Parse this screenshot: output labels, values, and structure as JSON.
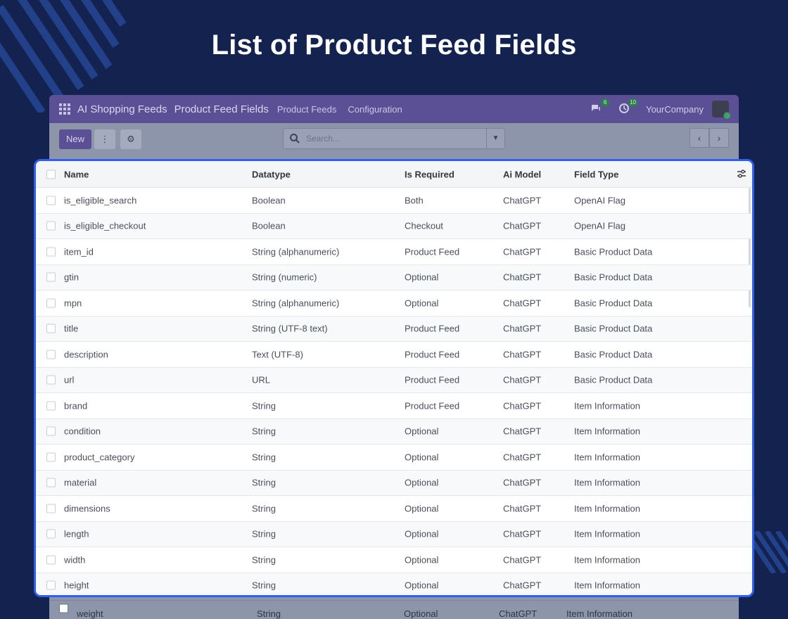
{
  "hero": {
    "title": "List of Product Feed Fields"
  },
  "navbar": {
    "app_name": "AI Shopping Feeds",
    "page_name": "Product Feed Fields",
    "menus": [
      "Product Feeds",
      "Configuration"
    ],
    "messages_count": "6",
    "activities_count": "10",
    "company": "YourCompany"
  },
  "controls": {
    "new_label": "New",
    "gear_icon": "gear-icon",
    "search_placeholder": "Search..."
  },
  "table": {
    "headers": [
      "Name",
      "Datatype",
      "Is Required",
      "Ai Model",
      "Field Type"
    ],
    "rows": [
      [
        "is_eligible_search",
        "Boolean",
        "Both",
        "ChatGPT",
        "OpenAI Flag"
      ],
      [
        "is_eligible_checkout",
        "Boolean",
        "Checkout",
        "ChatGPT",
        "OpenAI Flag"
      ],
      [
        "item_id",
        "String (alphanumeric)",
        "Product Feed",
        "ChatGPT",
        "Basic Product Data"
      ],
      [
        "gtin",
        "String (numeric)",
        "Optional",
        "ChatGPT",
        "Basic Product Data"
      ],
      [
        "mpn",
        "String (alphanumeric)",
        "Optional",
        "ChatGPT",
        "Basic Product Data"
      ],
      [
        "title",
        "String (UTF-8 text)",
        "Product Feed",
        "ChatGPT",
        "Basic Product Data"
      ],
      [
        "description",
        "Text (UTF-8)",
        "Product Feed",
        "ChatGPT",
        "Basic Product Data"
      ],
      [
        "url",
        "URL",
        "Product Feed",
        "ChatGPT",
        "Basic Product Data"
      ],
      [
        "brand",
        "String",
        "Product Feed",
        "ChatGPT",
        "Item Information"
      ],
      [
        "condition",
        "String",
        "Optional",
        "ChatGPT",
        "Item Information"
      ],
      [
        "product_category",
        "String",
        "Optional",
        "ChatGPT",
        "Item Information"
      ],
      [
        "material",
        "String",
        "Optional",
        "ChatGPT",
        "Item Information"
      ],
      [
        "dimensions",
        "String",
        "Optional",
        "ChatGPT",
        "Item Information"
      ],
      [
        "length",
        "String",
        "Optional",
        "ChatGPT",
        "Item Information"
      ],
      [
        "width",
        "String",
        "Optional",
        "ChatGPT",
        "Item Information"
      ],
      [
        "height",
        "String",
        "Optional",
        "ChatGPT",
        "Item Information"
      ]
    ],
    "below_row": [
      "weight",
      "String",
      "Optional",
      "ChatGPT",
      "Item Information"
    ]
  },
  "colors": {
    "background": "#13224f",
    "navbar": "#5b4f96",
    "highlight_border": "#2f5ef2"
  }
}
